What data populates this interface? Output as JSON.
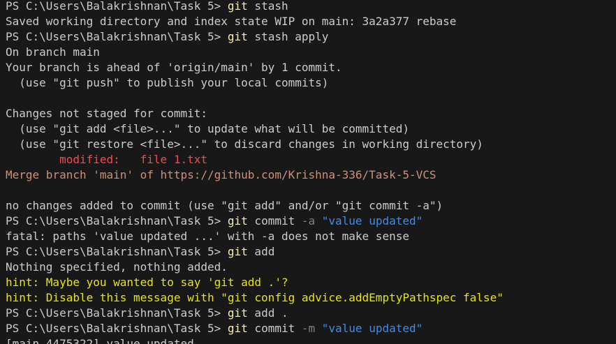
{
  "terminal": {
    "background": "#181818",
    "colors": {
      "text": "#cccccc",
      "command": "#f9f1a5",
      "flag": "#808080",
      "string": "#3b8eea",
      "modified": "#f14c4c",
      "merge": "#ce9178",
      "hint": "#e5e510"
    },
    "lines": [
      [
        {
          "t": "PS C:\\Users\\Balakrishnan\\Task 5> ",
          "c": "prompt"
        },
        {
          "t": "git",
          "c": "cmd"
        },
        {
          "t": " stash",
          "c": "plain"
        }
      ],
      [
        {
          "t": "Saved working directory and index state WIP on main: 3a2a377 rebase",
          "c": "plain"
        }
      ],
      [
        {
          "t": "PS C:\\Users\\Balakrishnan\\Task 5> ",
          "c": "prompt"
        },
        {
          "t": "git",
          "c": "cmd"
        },
        {
          "t": " stash apply",
          "c": "plain"
        }
      ],
      [
        {
          "t": "On branch main",
          "c": "plain"
        }
      ],
      [
        {
          "t": "Your branch is ahead of 'origin/main' by 1 commit.",
          "c": "plain"
        }
      ],
      [
        {
          "t": "  (use \"git push\" to publish your local commits)",
          "c": "plain"
        }
      ],
      [],
      [
        {
          "t": "Changes not staged for commit:",
          "c": "plain"
        }
      ],
      [
        {
          "t": "  (use \"git add <file>...\" to update what will be committed)",
          "c": "plain"
        }
      ],
      [
        {
          "t": "  (use \"git restore <file>...\" to discard changes in working directory)",
          "c": "plain"
        }
      ],
      [
        {
          "t": "        modified:   file 1.txt",
          "c": "mod"
        }
      ],
      [
        {
          "t": "Merge branch 'main' of https://github.com/Krishna-336/Task-5-VCS",
          "c": "merge"
        }
      ],
      [],
      [
        {
          "t": "no changes added to commit (use \"git add\" and/or \"git commit -a\")",
          "c": "plain"
        }
      ],
      [
        {
          "t": "PS C:\\Users\\Balakrishnan\\Task 5> ",
          "c": "prompt"
        },
        {
          "t": "git",
          "c": "cmd"
        },
        {
          "t": " commit ",
          "c": "plain"
        },
        {
          "t": "-a",
          "c": "flag"
        },
        {
          "t": " ",
          "c": "plain"
        },
        {
          "t": "\"value updated\"",
          "c": "str"
        }
      ],
      [
        {
          "t": "fatal: paths 'value updated ...' with -a does not make sense",
          "c": "plain"
        }
      ],
      [
        {
          "t": "PS C:\\Users\\Balakrishnan\\Task 5> ",
          "c": "prompt"
        },
        {
          "t": "git",
          "c": "cmd"
        },
        {
          "t": " add",
          "c": "plain"
        }
      ],
      [
        {
          "t": "Nothing specified, nothing added.",
          "c": "plain"
        }
      ],
      [
        {
          "t": "hint: Maybe you wanted to say 'git add .'?",
          "c": "hint"
        }
      ],
      [
        {
          "t": "hint: Disable this message with \"git config advice.addEmptyPathspec false\"",
          "c": "hint"
        }
      ],
      [
        {
          "t": "PS C:\\Users\\Balakrishnan\\Task 5> ",
          "c": "prompt"
        },
        {
          "t": "git",
          "c": "cmd"
        },
        {
          "t": " add .",
          "c": "plain"
        }
      ],
      [
        {
          "t": "PS C:\\Users\\Balakrishnan\\Task 5> ",
          "c": "prompt"
        },
        {
          "t": "git",
          "c": "cmd"
        },
        {
          "t": " commit ",
          "c": "plain"
        },
        {
          "t": "-m",
          "c": "flag"
        },
        {
          "t": " ",
          "c": "plain"
        },
        {
          "t": "\"value updated\"",
          "c": "str"
        }
      ],
      [
        {
          "t": "[main 4475322] value updated",
          "c": "plain"
        }
      ]
    ]
  }
}
